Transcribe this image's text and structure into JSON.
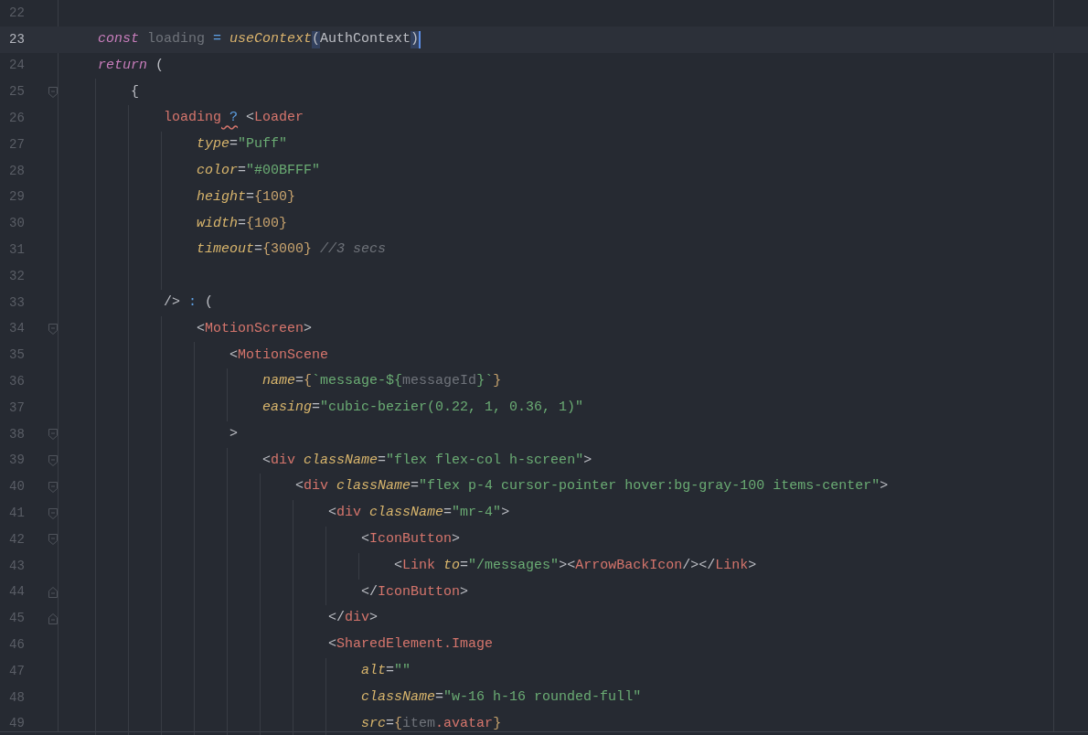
{
  "editor": {
    "lines": [
      {
        "number": "22",
        "current": false
      },
      {
        "number": "23",
        "current": true,
        "caret": true,
        "tokens": [
          {
            "text": "    const",
            "kind": "keyword"
          },
          {
            "text": " loading",
            "kind": "muted"
          },
          {
            "text": " = ",
            "kind": "operator"
          },
          {
            "text": "useContext",
            "kind": "function"
          },
          {
            "text": "(",
            "kind": "plain",
            "matched": true
          },
          {
            "text": "AuthContext",
            "kind": "plain"
          },
          {
            "text": ")",
            "kind": "plain",
            "matched": true
          }
        ]
      },
      {
        "number": "24",
        "current": false,
        "tokens": [
          {
            "text": "    return",
            "kind": "keyword"
          },
          {
            "text": " (",
            "kind": "plain"
          }
        ]
      },
      {
        "number": "25",
        "current": false,
        "fold_open": true,
        "tokens": [
          {
            "text": "        {",
            "kind": "plain"
          }
        ]
      },
      {
        "number": "26",
        "current": false,
        "tokens": [
          {
            "text": "            loading",
            "kind": "tag"
          },
          {
            "text": " ?",
            "kind": "operator",
            "warning": true
          },
          {
            "text": " <",
            "kind": "plain"
          },
          {
            "text": "Loader",
            "kind": "tag"
          }
        ]
      },
      {
        "number": "27",
        "current": false,
        "tokens": [
          {
            "text": "                type",
            "kind": "attribute"
          },
          {
            "text": "=",
            "kind": "plain"
          },
          {
            "text": "\"Puff\"",
            "kind": "string"
          }
        ]
      },
      {
        "number": "28",
        "current": false,
        "tokens": [
          {
            "text": "                color",
            "kind": "attribute"
          },
          {
            "text": "=",
            "kind": "plain"
          },
          {
            "text": "\"#00BFFF\"",
            "kind": "string"
          }
        ]
      },
      {
        "number": "29",
        "current": false,
        "tokens": [
          {
            "text": "                height",
            "kind": "attribute"
          },
          {
            "text": "=",
            "kind": "plain"
          },
          {
            "text": "{100}",
            "kind": "expression"
          }
        ]
      },
      {
        "number": "30",
        "current": false,
        "tokens": [
          {
            "text": "                width",
            "kind": "attribute"
          },
          {
            "text": "=",
            "kind": "plain"
          },
          {
            "text": "{100}",
            "kind": "expression"
          }
        ]
      },
      {
        "number": "31",
        "current": false,
        "tokens": [
          {
            "text": "                timeout",
            "kind": "attribute"
          },
          {
            "text": "=",
            "kind": "plain"
          },
          {
            "text": "{3000}",
            "kind": "expression"
          },
          {
            "text": " //3 secs",
            "kind": "comment"
          }
        ]
      },
      {
        "number": "32",
        "current": false
      },
      {
        "number": "33",
        "current": false,
        "tokens": [
          {
            "text": "            />",
            "kind": "plain"
          },
          {
            "text": " : ",
            "kind": "operator"
          },
          {
            "text": "(",
            "kind": "plain"
          }
        ]
      },
      {
        "number": "34",
        "current": false,
        "fold_open": true,
        "tokens": [
          {
            "text": "                <",
            "kind": "plain"
          },
          {
            "text": "MotionScreen",
            "kind": "tag"
          },
          {
            "text": ">",
            "kind": "plain"
          }
        ]
      },
      {
        "number": "35",
        "current": false,
        "tokens": [
          {
            "text": "                    <",
            "kind": "plain"
          },
          {
            "text": "MotionScene",
            "kind": "tag"
          }
        ]
      },
      {
        "number": "36",
        "current": false,
        "tokens": [
          {
            "text": "                        name",
            "kind": "attribute"
          },
          {
            "text": "=",
            "kind": "plain"
          },
          {
            "text": "{",
            "kind": "expression"
          },
          {
            "text": "`message-${",
            "kind": "string"
          },
          {
            "text": "messageId",
            "kind": "muted"
          },
          {
            "text": "}`",
            "kind": "string"
          },
          {
            "text": "}",
            "kind": "expression"
          }
        ]
      },
      {
        "number": "37",
        "current": false,
        "tokens": [
          {
            "text": "                        easing",
            "kind": "attribute"
          },
          {
            "text": "=",
            "kind": "plain"
          },
          {
            "text": "\"cubic-bezier(0.22, 1, 0.36, 1)\"",
            "kind": "string"
          }
        ]
      },
      {
        "number": "38",
        "current": false,
        "fold_open": true,
        "tokens": [
          {
            "text": "                    >",
            "kind": "plain"
          }
        ]
      },
      {
        "number": "39",
        "current": false,
        "fold_open": true,
        "tokens": [
          {
            "text": "                        <",
            "kind": "plain"
          },
          {
            "text": "div",
            "kind": "tag"
          },
          {
            "text": " className",
            "kind": "attribute"
          },
          {
            "text": "=",
            "kind": "plain"
          },
          {
            "text": "\"flex flex-col h-screen\"",
            "kind": "string"
          },
          {
            "text": ">",
            "kind": "plain"
          }
        ]
      },
      {
        "number": "40",
        "current": false,
        "fold_open": true,
        "tokens": [
          {
            "text": "                            <",
            "kind": "plain"
          },
          {
            "text": "div",
            "kind": "tag"
          },
          {
            "text": " className",
            "kind": "attribute"
          },
          {
            "text": "=",
            "kind": "plain"
          },
          {
            "text": "\"flex p-4 cursor-pointer hover:bg-gray-100 items-center\"",
            "kind": "string"
          },
          {
            "text": ">",
            "kind": "plain"
          }
        ]
      },
      {
        "number": "41",
        "current": false,
        "fold_open": true,
        "tokens": [
          {
            "text": "                                <",
            "kind": "plain"
          },
          {
            "text": "div",
            "kind": "tag"
          },
          {
            "text": " className",
            "kind": "attribute"
          },
          {
            "text": "=",
            "kind": "plain"
          },
          {
            "text": "\"mr-4\"",
            "kind": "string"
          },
          {
            "text": ">",
            "kind": "plain"
          }
        ]
      },
      {
        "number": "42",
        "current": false,
        "fold_open": true,
        "tokens": [
          {
            "text": "                                    <",
            "kind": "plain"
          },
          {
            "text": "IconButton",
            "kind": "tag"
          },
          {
            "text": ">",
            "kind": "plain"
          }
        ]
      },
      {
        "number": "43",
        "current": false,
        "tokens": [
          {
            "text": "                                        <",
            "kind": "plain"
          },
          {
            "text": "Link",
            "kind": "tag"
          },
          {
            "text": " to",
            "kind": "attribute"
          },
          {
            "text": "=",
            "kind": "plain"
          },
          {
            "text": "\"/messages\"",
            "kind": "string"
          },
          {
            "text": "><",
            "kind": "plain"
          },
          {
            "text": "ArrowBackIcon",
            "kind": "tag"
          },
          {
            "text": "/></",
            "kind": "plain"
          },
          {
            "text": "Link",
            "kind": "tag"
          },
          {
            "text": ">",
            "kind": "plain"
          }
        ]
      },
      {
        "number": "44",
        "current": false,
        "fold_close": true,
        "tokens": [
          {
            "text": "                                    </",
            "kind": "plain"
          },
          {
            "text": "IconButton",
            "kind": "tag"
          },
          {
            "text": ">",
            "kind": "plain"
          }
        ]
      },
      {
        "number": "45",
        "current": false,
        "fold_close": true,
        "tokens": [
          {
            "text": "                                </",
            "kind": "plain"
          },
          {
            "text": "div",
            "kind": "tag"
          },
          {
            "text": ">",
            "kind": "plain"
          }
        ]
      },
      {
        "number": "46",
        "current": false,
        "tokens": [
          {
            "text": "                                <",
            "kind": "plain"
          },
          {
            "text": "SharedElement.Image",
            "kind": "tag"
          }
        ]
      },
      {
        "number": "47",
        "current": false,
        "tokens": [
          {
            "text": "                                    alt",
            "kind": "attribute"
          },
          {
            "text": "=",
            "kind": "plain"
          },
          {
            "text": "\"\"",
            "kind": "string"
          }
        ]
      },
      {
        "number": "48",
        "current": false,
        "tokens": [
          {
            "text": "                                    className",
            "kind": "attribute"
          },
          {
            "text": "=",
            "kind": "plain"
          },
          {
            "text": "\"w-16 h-16 rounded-full\"",
            "kind": "string"
          }
        ]
      },
      {
        "number": "49",
        "current": false,
        "tokens": [
          {
            "text": "                                    src",
            "kind": "attribute"
          },
          {
            "text": "=",
            "kind": "plain"
          },
          {
            "text": "{",
            "kind": "expression"
          },
          {
            "text": "item",
            "kind": "muted"
          },
          {
            "text": ".avatar",
            "kind": "tag"
          },
          {
            "text": "}",
            "kind": "expression"
          }
        ]
      }
    ]
  }
}
